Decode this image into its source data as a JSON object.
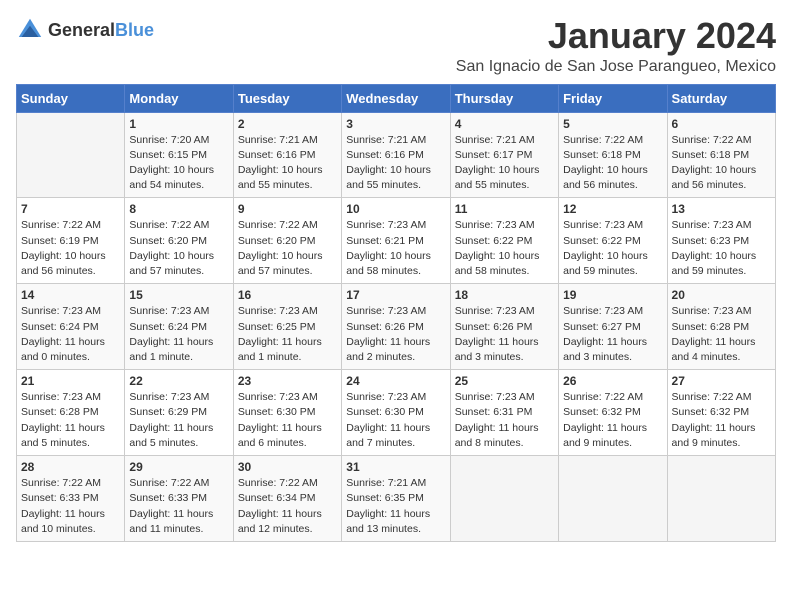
{
  "logo": {
    "general": "General",
    "blue": "Blue"
  },
  "title": "January 2024",
  "location": "San Ignacio de San Jose Parangueo, Mexico",
  "days_of_week": [
    "Sunday",
    "Monday",
    "Tuesday",
    "Wednesday",
    "Thursday",
    "Friday",
    "Saturday"
  ],
  "weeks": [
    [
      {
        "date": "",
        "info": ""
      },
      {
        "date": "1",
        "info": "Sunrise: 7:20 AM\nSunset: 6:15 PM\nDaylight: 10 hours\nand 54 minutes."
      },
      {
        "date": "2",
        "info": "Sunrise: 7:21 AM\nSunset: 6:16 PM\nDaylight: 10 hours\nand 55 minutes."
      },
      {
        "date": "3",
        "info": "Sunrise: 7:21 AM\nSunset: 6:16 PM\nDaylight: 10 hours\nand 55 minutes."
      },
      {
        "date": "4",
        "info": "Sunrise: 7:21 AM\nSunset: 6:17 PM\nDaylight: 10 hours\nand 55 minutes."
      },
      {
        "date": "5",
        "info": "Sunrise: 7:22 AM\nSunset: 6:18 PM\nDaylight: 10 hours\nand 56 minutes."
      },
      {
        "date": "6",
        "info": "Sunrise: 7:22 AM\nSunset: 6:18 PM\nDaylight: 10 hours\nand 56 minutes."
      }
    ],
    [
      {
        "date": "7",
        "info": "Sunrise: 7:22 AM\nSunset: 6:19 PM\nDaylight: 10 hours\nand 56 minutes."
      },
      {
        "date": "8",
        "info": "Sunrise: 7:22 AM\nSunset: 6:20 PM\nDaylight: 10 hours\nand 57 minutes."
      },
      {
        "date": "9",
        "info": "Sunrise: 7:22 AM\nSunset: 6:20 PM\nDaylight: 10 hours\nand 57 minutes."
      },
      {
        "date": "10",
        "info": "Sunrise: 7:23 AM\nSunset: 6:21 PM\nDaylight: 10 hours\nand 58 minutes."
      },
      {
        "date": "11",
        "info": "Sunrise: 7:23 AM\nSunset: 6:22 PM\nDaylight: 10 hours\nand 58 minutes."
      },
      {
        "date": "12",
        "info": "Sunrise: 7:23 AM\nSunset: 6:22 PM\nDaylight: 10 hours\nand 59 minutes."
      },
      {
        "date": "13",
        "info": "Sunrise: 7:23 AM\nSunset: 6:23 PM\nDaylight: 10 hours\nand 59 minutes."
      }
    ],
    [
      {
        "date": "14",
        "info": "Sunrise: 7:23 AM\nSunset: 6:24 PM\nDaylight: 11 hours\nand 0 minutes."
      },
      {
        "date": "15",
        "info": "Sunrise: 7:23 AM\nSunset: 6:24 PM\nDaylight: 11 hours\nand 1 minute."
      },
      {
        "date": "16",
        "info": "Sunrise: 7:23 AM\nSunset: 6:25 PM\nDaylight: 11 hours\nand 1 minute."
      },
      {
        "date": "17",
        "info": "Sunrise: 7:23 AM\nSunset: 6:26 PM\nDaylight: 11 hours\nand 2 minutes."
      },
      {
        "date": "18",
        "info": "Sunrise: 7:23 AM\nSunset: 6:26 PM\nDaylight: 11 hours\nand 3 minutes."
      },
      {
        "date": "19",
        "info": "Sunrise: 7:23 AM\nSunset: 6:27 PM\nDaylight: 11 hours\nand 3 minutes."
      },
      {
        "date": "20",
        "info": "Sunrise: 7:23 AM\nSunset: 6:28 PM\nDaylight: 11 hours\nand 4 minutes."
      }
    ],
    [
      {
        "date": "21",
        "info": "Sunrise: 7:23 AM\nSunset: 6:28 PM\nDaylight: 11 hours\nand 5 minutes."
      },
      {
        "date": "22",
        "info": "Sunrise: 7:23 AM\nSunset: 6:29 PM\nDaylight: 11 hours\nand 5 minutes."
      },
      {
        "date": "23",
        "info": "Sunrise: 7:23 AM\nSunset: 6:30 PM\nDaylight: 11 hours\nand 6 minutes."
      },
      {
        "date": "24",
        "info": "Sunrise: 7:23 AM\nSunset: 6:30 PM\nDaylight: 11 hours\nand 7 minutes."
      },
      {
        "date": "25",
        "info": "Sunrise: 7:23 AM\nSunset: 6:31 PM\nDaylight: 11 hours\nand 8 minutes."
      },
      {
        "date": "26",
        "info": "Sunrise: 7:22 AM\nSunset: 6:32 PM\nDaylight: 11 hours\nand 9 minutes."
      },
      {
        "date": "27",
        "info": "Sunrise: 7:22 AM\nSunset: 6:32 PM\nDaylight: 11 hours\nand 9 minutes."
      }
    ],
    [
      {
        "date": "28",
        "info": "Sunrise: 7:22 AM\nSunset: 6:33 PM\nDaylight: 11 hours\nand 10 minutes."
      },
      {
        "date": "29",
        "info": "Sunrise: 7:22 AM\nSunset: 6:33 PM\nDaylight: 11 hours\nand 11 minutes."
      },
      {
        "date": "30",
        "info": "Sunrise: 7:22 AM\nSunset: 6:34 PM\nDaylight: 11 hours\nand 12 minutes."
      },
      {
        "date": "31",
        "info": "Sunrise: 7:21 AM\nSunset: 6:35 PM\nDaylight: 11 hours\nand 13 minutes."
      },
      {
        "date": "",
        "info": ""
      },
      {
        "date": "",
        "info": ""
      },
      {
        "date": "",
        "info": ""
      }
    ]
  ]
}
